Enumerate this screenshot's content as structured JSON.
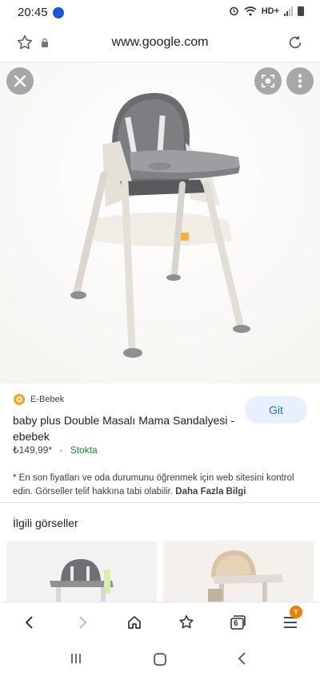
{
  "status_bar": {
    "time": "20:45",
    "network": "HD+"
  },
  "address_bar": {
    "url": "www.google.com"
  },
  "result": {
    "source_name": "E-Bebek",
    "title": "baby plus Double Masalı Mama Sandalyesi - ebebek",
    "price": "₺149,99*",
    "separator": "·",
    "stock": "Stokta",
    "visit_label": "Git",
    "disclaimer": "* En son fiyatları ve oda durumunu öğrenmek için web sitesini kontrol edin. Görseller telif hakkına tabi olabilir.",
    "more_info": "Daha Fazla Bilgi"
  },
  "related": {
    "heading": "İlgili görseller"
  },
  "toolbar": {
    "tab_count": "6",
    "badge": "Y"
  },
  "colors": {
    "accent": "#1a73e8",
    "stock": "#188038",
    "badge": "#f57c00"
  }
}
